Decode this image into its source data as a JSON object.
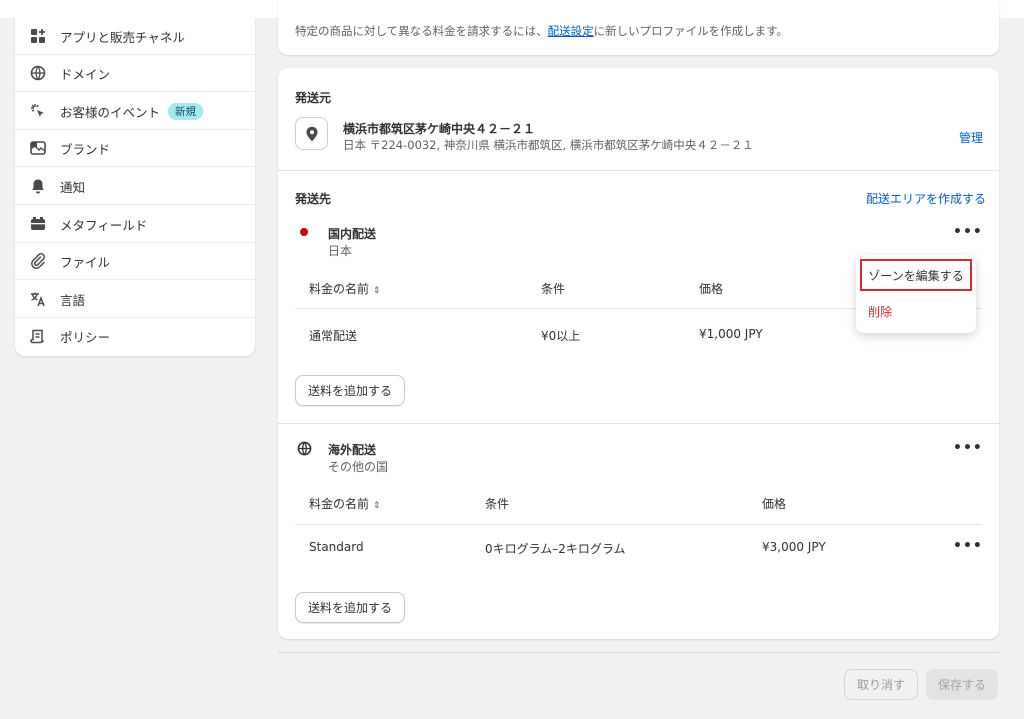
{
  "sidebar": {
    "items": [
      {
        "label": "アプリと販売チャネル",
        "icon": "apps-icon"
      },
      {
        "label": "ドメイン",
        "icon": "globe-icon"
      },
      {
        "label": "お客様のイベント",
        "icon": "cursor-click-icon",
        "badge": "新規"
      },
      {
        "label": "ブランド",
        "icon": "brand-icon"
      },
      {
        "label": "通知",
        "icon": "bell-icon"
      },
      {
        "label": "メタフィールド",
        "icon": "metafield-icon"
      },
      {
        "label": "ファイル",
        "icon": "paperclip-icon"
      },
      {
        "label": "言語",
        "icon": "translate-icon"
      },
      {
        "label": "ポリシー",
        "icon": "policy-icon"
      }
    ]
  },
  "top_card": {
    "text_before": "特定の商品に対して異なる料金を請求するには、",
    "link": "配送設定",
    "text_after": "に新しいプロファイルを作成します。"
  },
  "origin": {
    "heading": "発送元",
    "name": "横浜市都筑区茅ケ崎中央４２－２１",
    "address": "日本 〒224-0032, 神奈川県 横浜市都筑区, 横浜市都筑区茅ケ崎中央４２－２１",
    "manage": "管理"
  },
  "destination": {
    "heading": "発送先",
    "create_zone": "配送エリアを作成する"
  },
  "zones": [
    {
      "name": "国内配送",
      "sub": "日本",
      "headers": {
        "rate": "料金の名前",
        "condition": "条件",
        "price": "価格"
      },
      "rows": [
        {
          "rate": "通常配送",
          "condition": "¥0以上",
          "price": "¥1,000 JPY"
        }
      ],
      "add_rate": "送料を追加する"
    },
    {
      "name": "海外配送",
      "sub": "その他の国",
      "headers": {
        "rate": "料金の名前",
        "condition": "条件",
        "price": "価格"
      },
      "rows": [
        {
          "rate": "Standard",
          "condition": "0キログラム–2キログラム",
          "price": "¥3,000 JPY"
        }
      ],
      "add_rate": "送料を追加する"
    }
  ],
  "menu": {
    "edit_zone": "ゾーンを編集する",
    "delete": "削除"
  },
  "footer": {
    "cancel": "取り消す",
    "save": "保存する"
  },
  "more": "•••",
  "sort": "⇕",
  "colors": {
    "accent": "#005bd3",
    "danger": "#d72c2c",
    "badge_bg": "#a5e8f2"
  }
}
